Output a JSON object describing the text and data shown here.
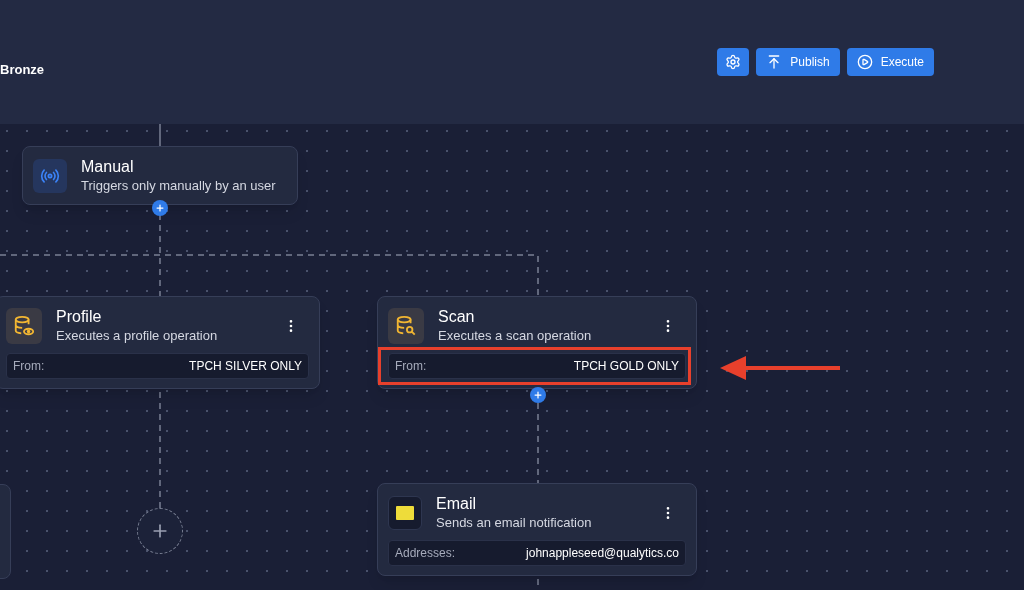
{
  "header": {
    "title": "Bronze",
    "buttons": [
      {
        "kind": "settings"
      },
      {
        "kind": "publish",
        "label": "Publish"
      },
      {
        "kind": "execute",
        "label": "Execute"
      }
    ]
  },
  "nodes": [
    {
      "kind": "trigger",
      "title": "Manual",
      "description": "Triggers only manually by an user"
    },
    {
      "kind": "profile",
      "title": "Profile",
      "description": "Executes a profile operation",
      "field": {
        "label": "From:",
        "value": "TPCH SILVER ONLY"
      },
      "highlighted": false
    },
    {
      "kind": "scan",
      "title": "Scan",
      "description": "Executes a scan operation",
      "field": {
        "label": "From:",
        "value": "TPCH GOLD ONLY"
      },
      "highlighted": true
    },
    {
      "kind": "email",
      "title": "Email",
      "description": "Sends an email notification",
      "field": {
        "label": "Addresses:",
        "value": "johnappleseed@qualytics.co"
      },
      "highlighted": false
    }
  ]
}
